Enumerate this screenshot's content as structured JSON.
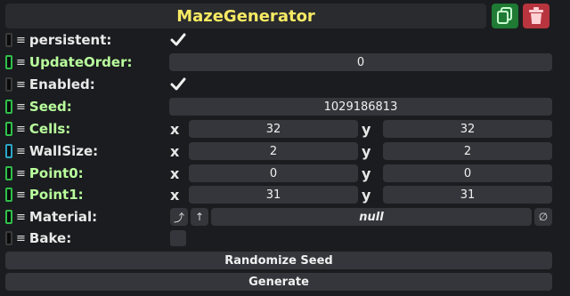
{
  "header": {
    "title": "MazeGenerator",
    "copy_icon": "copy-icon",
    "delete_icon": "trash-icon",
    "colors": {
      "title": "#f6ea63",
      "copy_bg": "#1f7a34",
      "delete_bg": "#b8343e"
    }
  },
  "fields": {
    "persistent": {
      "label": "persistent:",
      "checked": true
    },
    "update_order": {
      "label": "UpdateOrder:",
      "value": "0"
    },
    "enabled": {
      "label": "Enabled:",
      "checked": true
    },
    "seed": {
      "label": "Seed:",
      "value": "1029186813"
    },
    "cells": {
      "label": "Cells:",
      "x_label": "x",
      "x": "32",
      "y_label": "y",
      "y": "32"
    },
    "wall_size": {
      "label": "WallSize:",
      "x_label": "x",
      "x": "2",
      "y_label": "y",
      "y": "2"
    },
    "point0": {
      "label": "Point0:",
      "x_label": "x",
      "x": "0",
      "y_label": "y",
      "y": "0"
    },
    "point1": {
      "label": "Point1:",
      "x_label": "x",
      "x": "31",
      "y_label": "y",
      "y": "31"
    },
    "material": {
      "label": "Material:",
      "value": "null",
      "btn1": "⤴",
      "btn2": "↑",
      "clear": "∅"
    },
    "bake": {
      "label": "Bake:",
      "checked": false
    }
  },
  "actions": {
    "randomize": "Randomize Seed",
    "generate": "Generate"
  }
}
